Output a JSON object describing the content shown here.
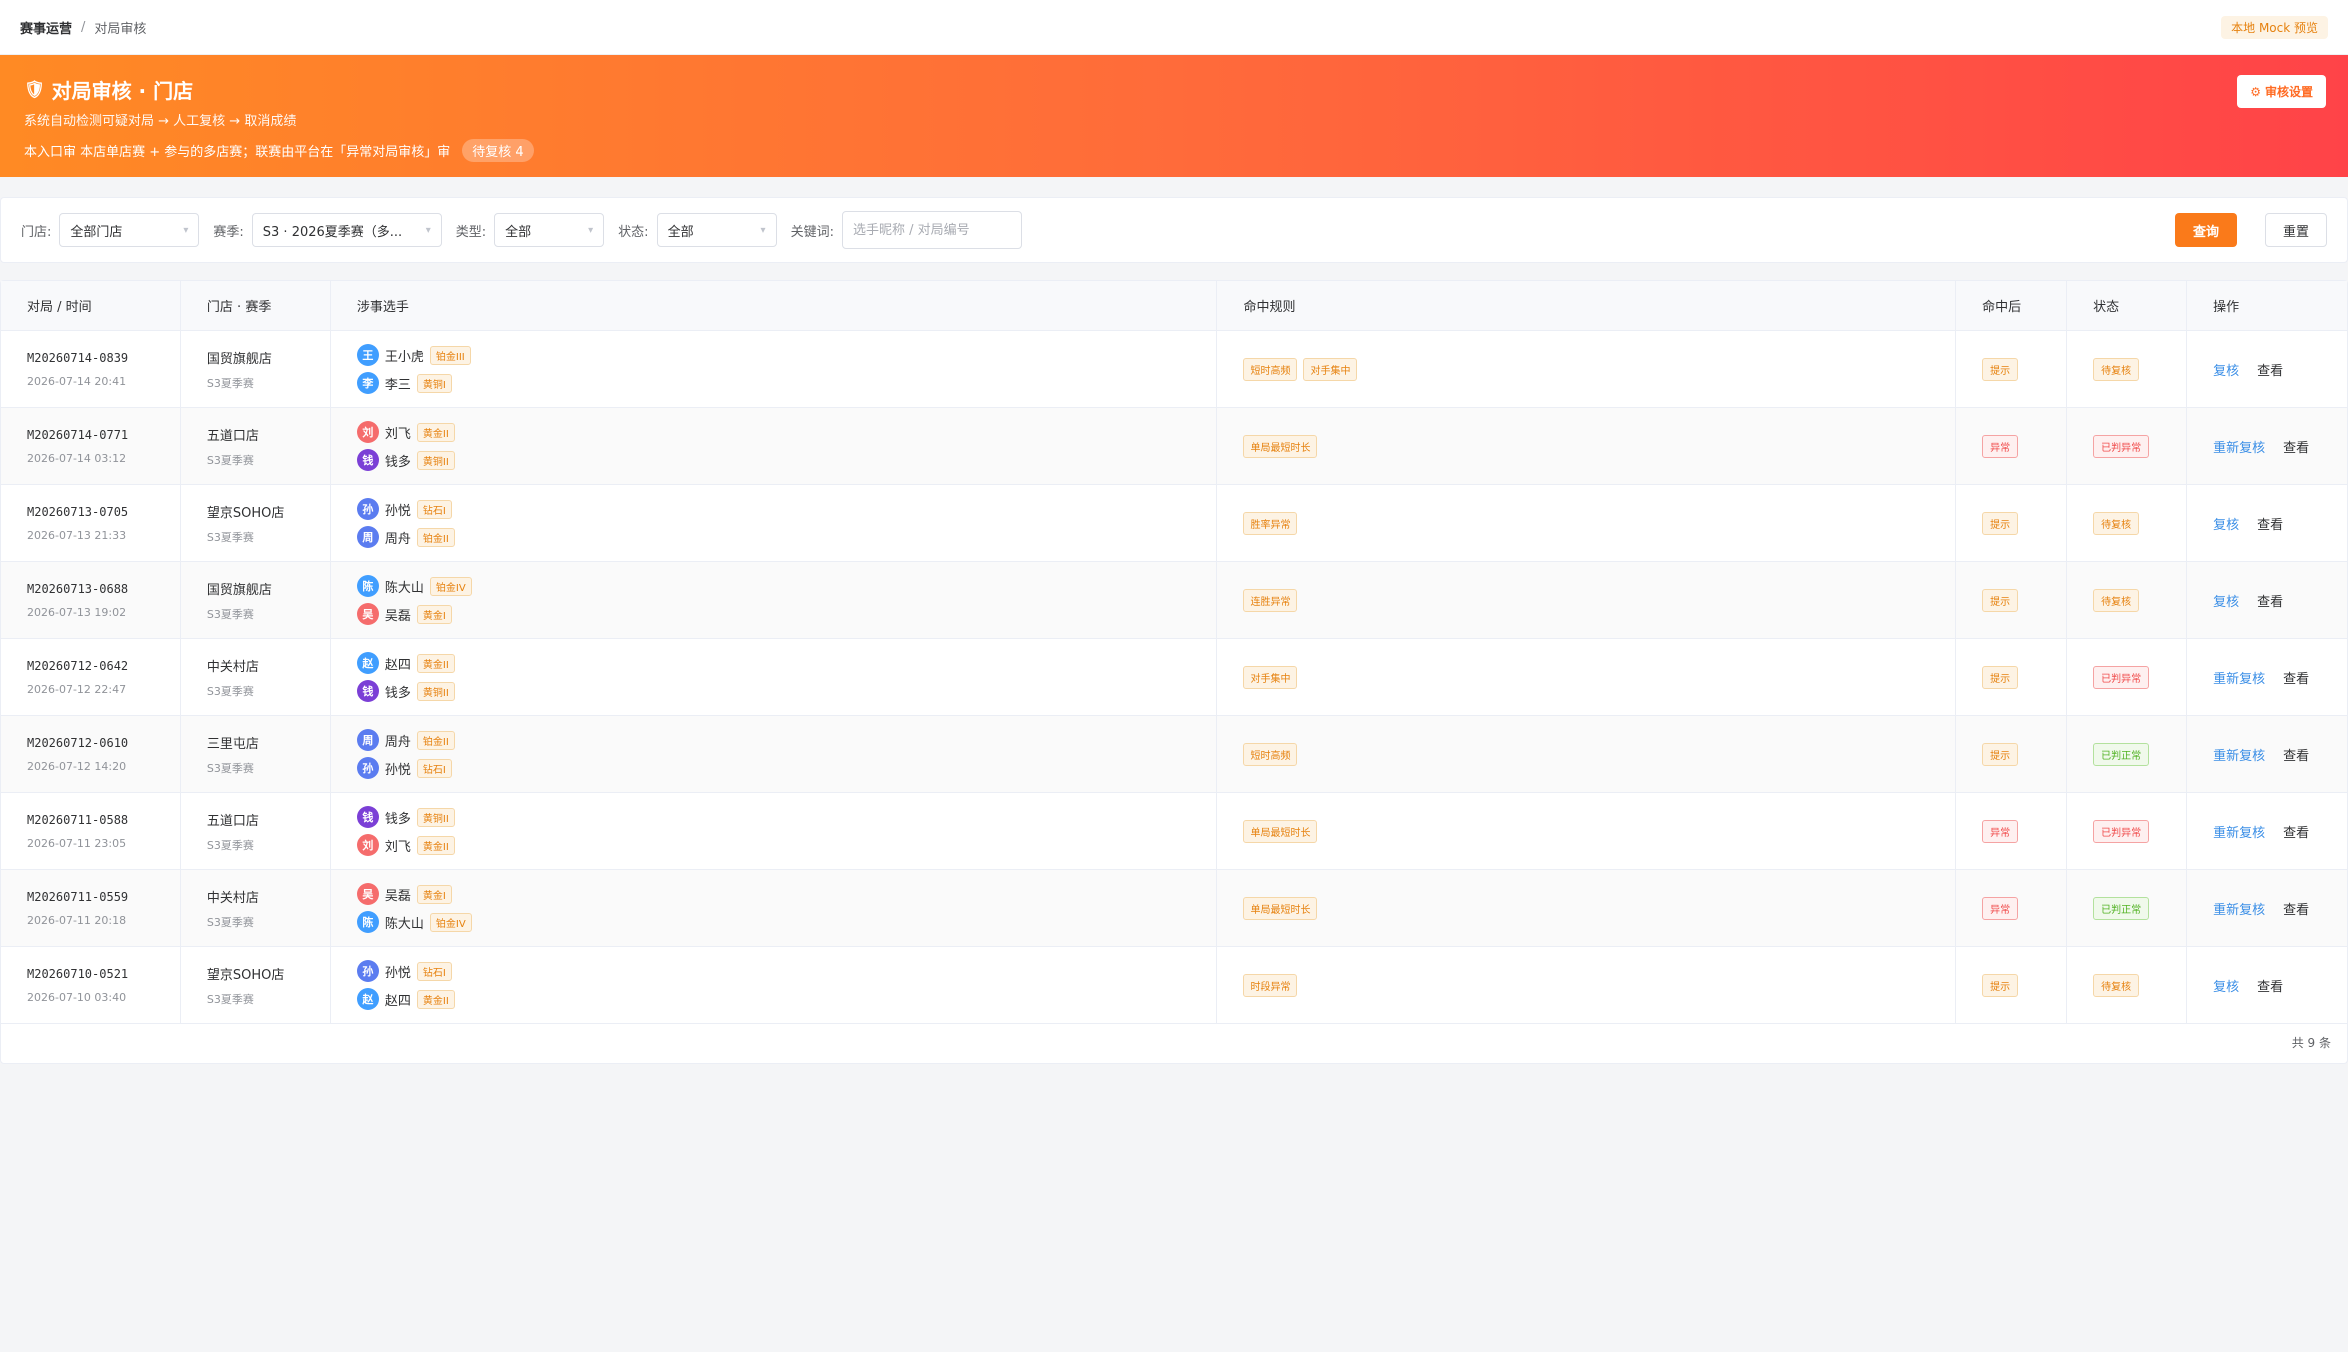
{
  "breadcrumb": {
    "root": "赛事运营",
    "sep": "/",
    "current": "对局审核"
  },
  "mock_badge": "本地 Mock 预览",
  "hero": {
    "title": "对局审核 · 门店",
    "subtitle": "系统自动检测可疑对局 → 人工复核 → 取消成绩",
    "note": "本入口审 本店单店赛 + 参与的多店赛；联赛由平台在「异常对局审核」审",
    "pending": "待复核 4",
    "settings_btn": "审核设置"
  },
  "filters": {
    "store_label": "门店:",
    "store_value": "全部门店",
    "season_label": "赛季:",
    "season_value": "S3 · 2026夏季赛（多...",
    "type_label": "类型:",
    "type_value": "全部",
    "status_label": "状态:",
    "status_value": "全部",
    "keyword_label": "关键词:",
    "keyword_placeholder": "选手昵称 / 对局编号",
    "query_btn": "查询",
    "reset_btn": "重置"
  },
  "table": {
    "headers": [
      "对局 / 时间",
      "门店 · 赛季",
      "涉事选手",
      "命中规则",
      "命中后",
      "状态",
      "操作"
    ],
    "rows": [
      {
        "id": "M20260714-0839",
        "time": "2026-07-14 20:41",
        "store": "国贸旗舰店",
        "season": "S3夏季赛",
        "players": [
          {
            "initial": "王",
            "name": "王小虎",
            "rank": "铂金III",
            "color": "#409eff"
          },
          {
            "initial": "李",
            "name": "李三",
            "rank": "黄铜I",
            "color": "#409eff"
          }
        ],
        "rules": [
          "短时高频",
          "对手集中"
        ],
        "after": "提示",
        "after_type": "orange",
        "status": "待复核",
        "status_type": "orange",
        "op": "复核",
        "view": "查看"
      },
      {
        "id": "M20260714-0771",
        "time": "2026-07-14 03:12",
        "store": "五道口店",
        "season": "S3夏季赛",
        "players": [
          {
            "initial": "刘",
            "name": "刘飞",
            "rank": "黄金II",
            "color": "#f56c6c"
          },
          {
            "initial": "钱",
            "name": "钱多",
            "rank": "黄铜II",
            "color": "#7b3fd6"
          }
        ],
        "rules": [
          "单局最短时长"
        ],
        "after": "异常",
        "after_type": "red",
        "status": "已判异常",
        "status_type": "red",
        "op": "重新复核",
        "view": "查看"
      },
      {
        "id": "M20260713-0705",
        "time": "2026-07-13 21:33",
        "store": "望京SOHO店",
        "season": "S3夏季赛",
        "players": [
          {
            "initial": "孙",
            "name": "孙悦",
            "rank": "钻石I",
            "color": "#5b7cf0"
          },
          {
            "initial": "周",
            "name": "周舟",
            "rank": "铂金II",
            "color": "#5b7cf0"
          }
        ],
        "rules": [
          "胜率异常"
        ],
        "after": "提示",
        "after_type": "orange",
        "status": "待复核",
        "status_type": "orange",
        "op": "复核",
        "view": "查看"
      },
      {
        "id": "M20260713-0688",
        "time": "2026-07-13 19:02",
        "store": "国贸旗舰店",
        "season": "S3夏季赛",
        "players": [
          {
            "initial": "陈",
            "name": "陈大山",
            "rank": "铂金IV",
            "color": "#409eff"
          },
          {
            "initial": "吴",
            "name": "吴磊",
            "rank": "黄金I",
            "color": "#f56c6c"
          }
        ],
        "rules": [
          "连胜异常"
        ],
        "after": "提示",
        "after_type": "orange",
        "status": "待复核",
        "status_type": "orange",
        "op": "复核",
        "view": "查看"
      },
      {
        "id": "M20260712-0642",
        "time": "2026-07-12 22:47",
        "store": "中关村店",
        "season": "S3夏季赛",
        "players": [
          {
            "initial": "赵",
            "name": "赵四",
            "rank": "黄金II",
            "color": "#409eff"
          },
          {
            "initial": "钱",
            "name": "钱多",
            "rank": "黄铜II",
            "color": "#7b3fd6"
          }
        ],
        "rules": [
          "对手集中"
        ],
        "after": "提示",
        "after_type": "orange",
        "status": "已判异常",
        "status_type": "red",
        "op": "重新复核",
        "view": "查看"
      },
      {
        "id": "M20260712-0610",
        "time": "2026-07-12 14:20",
        "store": "三里屯店",
        "season": "S3夏季赛",
        "players": [
          {
            "initial": "周",
            "name": "周舟",
            "rank": "铂金II",
            "color": "#5b7cf0"
          },
          {
            "initial": "孙",
            "name": "孙悦",
            "rank": "钻石I",
            "color": "#5b7cf0"
          }
        ],
        "rules": [
          "短时高频"
        ],
        "after": "提示",
        "after_type": "orange",
        "status": "已判正常",
        "status_type": "green",
        "op": "重新复核",
        "view": "查看"
      },
      {
        "id": "M20260711-0588",
        "time": "2026-07-11 23:05",
        "store": "五道口店",
        "season": "S3夏季赛",
        "players": [
          {
            "initial": "钱",
            "name": "钱多",
            "rank": "黄铜II",
            "color": "#7b3fd6"
          },
          {
            "initial": "刘",
            "name": "刘飞",
            "rank": "黄金II",
            "color": "#f56c6c"
          }
        ],
        "rules": [
          "单局最短时长"
        ],
        "after": "异常",
        "after_type": "red",
        "status": "已判异常",
        "status_type": "red",
        "op": "重新复核",
        "view": "查看"
      },
      {
        "id": "M20260711-0559",
        "time": "2026-07-11 20:18",
        "store": "中关村店",
        "season": "S3夏季赛",
        "players": [
          {
            "initial": "吴",
            "name": "吴磊",
            "rank": "黄金I",
            "color": "#f56c6c"
          },
          {
            "initial": "陈",
            "name": "陈大山",
            "rank": "铂金IV",
            "color": "#409eff"
          }
        ],
        "rules": [
          "单局最短时长"
        ],
        "after": "异常",
        "after_type": "red",
        "status": "已判正常",
        "status_type": "green",
        "op": "重新复核",
        "view": "查看"
      },
      {
        "id": "M20260710-0521",
        "time": "2026-07-10 03:40",
        "store": "望京SOHO店",
        "season": "S3夏季赛",
        "players": [
          {
            "initial": "孙",
            "name": "孙悦",
            "rank": "钻石I",
            "color": "#5b7cf0"
          },
          {
            "initial": "赵",
            "name": "赵四",
            "rank": "黄金II",
            "color": "#409eff"
          }
        ],
        "rules": [
          "时段异常"
        ],
        "after": "提示",
        "after_type": "orange",
        "status": "待复核",
        "status_type": "orange",
        "op": "复核",
        "view": "查看"
      }
    ],
    "total": "共 9 条"
  },
  "colors": {
    "accent": "#fa7a1a",
    "link": "#3a8ee6",
    "hero_start": "#ff8a24",
    "hero_end": "#ff4348"
  }
}
